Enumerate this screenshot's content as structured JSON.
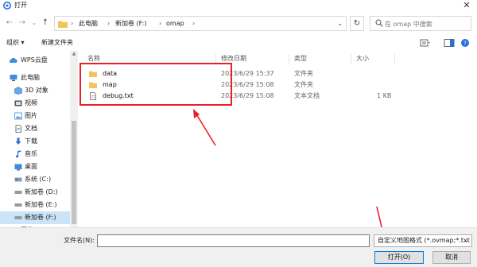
{
  "window": {
    "title": "打开",
    "close_glyph": "✕"
  },
  "navigation": {
    "back": "←",
    "forward": "→",
    "recent": "⌄",
    "up": "↑"
  },
  "address": {
    "crumbs": [
      "此电脑",
      "新加卷 (F:)",
      "omap"
    ],
    "separator": "›",
    "dropdown": "⌄",
    "refresh": "↻"
  },
  "search": {
    "placeholder": "在 omap 中搜索"
  },
  "toolbar": {
    "organize": "组织 ▾",
    "new_folder": "新建文件夹"
  },
  "sidebar": {
    "items": [
      {
        "label": "WPS云盘",
        "icon": "cloud-icon"
      },
      {
        "label": "此电脑",
        "icon": "computer-icon"
      },
      {
        "label": "3D 对象",
        "icon": "3d-objects-icon"
      },
      {
        "label": "视频",
        "icon": "video-icon"
      },
      {
        "label": "图片",
        "icon": "pictures-icon"
      },
      {
        "label": "文档",
        "icon": "documents-icon"
      },
      {
        "label": "下载",
        "icon": "download-icon"
      },
      {
        "label": "音乐",
        "icon": "music-icon"
      },
      {
        "label": "桌面",
        "icon": "desktop-icon"
      },
      {
        "label": "系统 (C:)",
        "icon": "drive-icon"
      },
      {
        "label": "新加卷 (D:)",
        "icon": "drive-icon"
      },
      {
        "label": "新加卷 (E:)",
        "icon": "drive-icon"
      },
      {
        "label": "新加卷 (F:)",
        "icon": "drive-icon",
        "selected": true
      },
      {
        "label": "网络",
        "icon": "network-icon"
      }
    ]
  },
  "file_list": {
    "columns": {
      "name": "名称",
      "modified": "修改日期",
      "type": "类型",
      "size": "大小"
    },
    "rows": [
      {
        "name": "data",
        "modified": "2023/6/29 15:37",
        "type": "文件夹",
        "size": "",
        "icon": "folder-icon"
      },
      {
        "name": "map",
        "modified": "2023/6/29 15:08",
        "type": "文件夹",
        "size": "",
        "icon": "folder-icon"
      },
      {
        "name": "debug.txt",
        "modified": "2023/6/29 15:08",
        "type": "文本文档",
        "size": "1 KB",
        "icon": "text-file-icon"
      }
    ]
  },
  "footer": {
    "filename_label": "文件名(N):",
    "filename_value": "",
    "filetype": "自定义地图格式 (*.ovmap;*.txt",
    "open_button": "打开(O)",
    "cancel_button": "取消"
  },
  "colors": {
    "annotation": "#e8202a",
    "selection": "#cce4f7",
    "folder": "#f2c55c",
    "accent": "#0078d7"
  }
}
